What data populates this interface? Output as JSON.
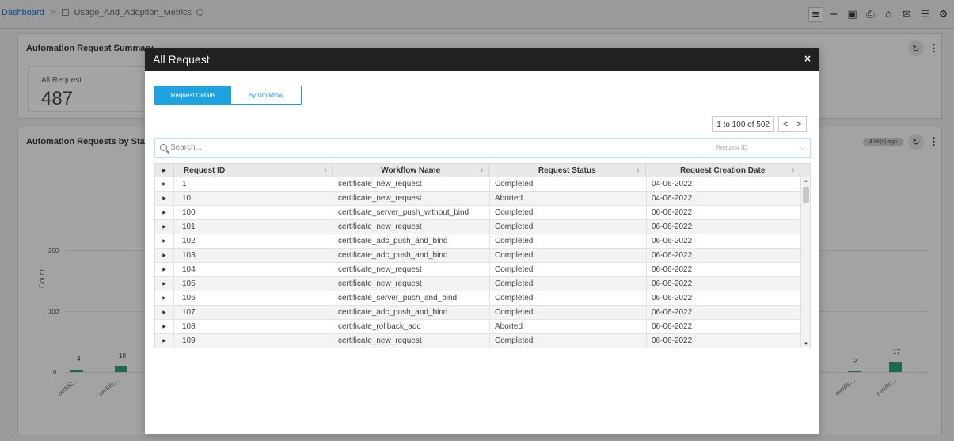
{
  "breadcrumb": {
    "root": "Dashboard",
    "separator": ">",
    "current": "Usage_And_Adoption_Metrics"
  },
  "toolbar": {
    "icons": [
      "menu-icon",
      "add-icon",
      "save-icon",
      "export-icon",
      "lock-icon",
      "mail-icon",
      "filter-icon",
      "settings-icon"
    ]
  },
  "summary_card": {
    "title": "Automation Request Summary",
    "metric_label": "All Request",
    "metric_value": "487"
  },
  "status_card": {
    "title": "Automation Requests by Stat",
    "time_badge": "4 Hr(s) ago",
    "y_axis_title": "Count",
    "y_ticks": [
      "200",
      "100",
      "0"
    ],
    "bar_labels": [
      "4",
      "10",
      "2",
      "17"
    ],
    "x_categories": [
      "certific...",
      "certific...",
      "certific...",
      "certific..."
    ],
    "bar_values": [
      4,
      10,
      2,
      17
    ],
    "bar_color": "#28a07a"
  },
  "modal": {
    "title": "All Request",
    "close_label": "×",
    "tabs": [
      {
        "label": "Request Details",
        "active": true
      },
      {
        "label": "By Workflow",
        "active": false
      }
    ],
    "pager": {
      "text": "1 to 100 of 502",
      "prev": "<",
      "next": ">"
    },
    "search": {
      "placeholder": "Search...",
      "field_placeholder": "Request ID"
    },
    "columns": [
      "Request ID",
      "Workflow Name",
      "Request Status",
      "Request Creation Date"
    ],
    "rows": [
      {
        "id": "1",
        "workflow": "certificate_new_request",
        "status": "Completed",
        "date": "04-06-2022"
      },
      {
        "id": "10",
        "workflow": "certificate_new_request",
        "status": "Aborted",
        "date": "04-06-2022"
      },
      {
        "id": "100",
        "workflow": "certificate_server_push_without_bind",
        "status": "Completed",
        "date": "06-06-2022"
      },
      {
        "id": "101",
        "workflow": "certificate_new_request",
        "status": "Completed",
        "date": "06-06-2022"
      },
      {
        "id": "102",
        "workflow": "certificate_adc_push_and_bind",
        "status": "Completed",
        "date": "06-06-2022"
      },
      {
        "id": "103",
        "workflow": "certificate_adc_push_and_bind",
        "status": "Completed",
        "date": "06-06-2022"
      },
      {
        "id": "104",
        "workflow": "certificate_new_request",
        "status": "Completed",
        "date": "06-06-2022"
      },
      {
        "id": "105",
        "workflow": "certificate_new_request",
        "status": "Completed",
        "date": "06-06-2022"
      },
      {
        "id": "106",
        "workflow": "certificate_server_push_and_bind",
        "status": "Completed",
        "date": "06-06-2022"
      },
      {
        "id": "107",
        "workflow": "certificate_adc_push_and_bind",
        "status": "Completed",
        "date": "06-06-2022"
      },
      {
        "id": "108",
        "workflow": "certificate_rollback_adc",
        "status": "Aborted",
        "date": "06-06-2022"
      },
      {
        "id": "109",
        "workflow": "certificate_new_request",
        "status": "Completed",
        "date": "06-06-2022"
      }
    ]
  },
  "colors": {
    "accent": "#1fa3e0",
    "modal_header": "#212121",
    "breadcrumb_link": "#1a73c8"
  }
}
